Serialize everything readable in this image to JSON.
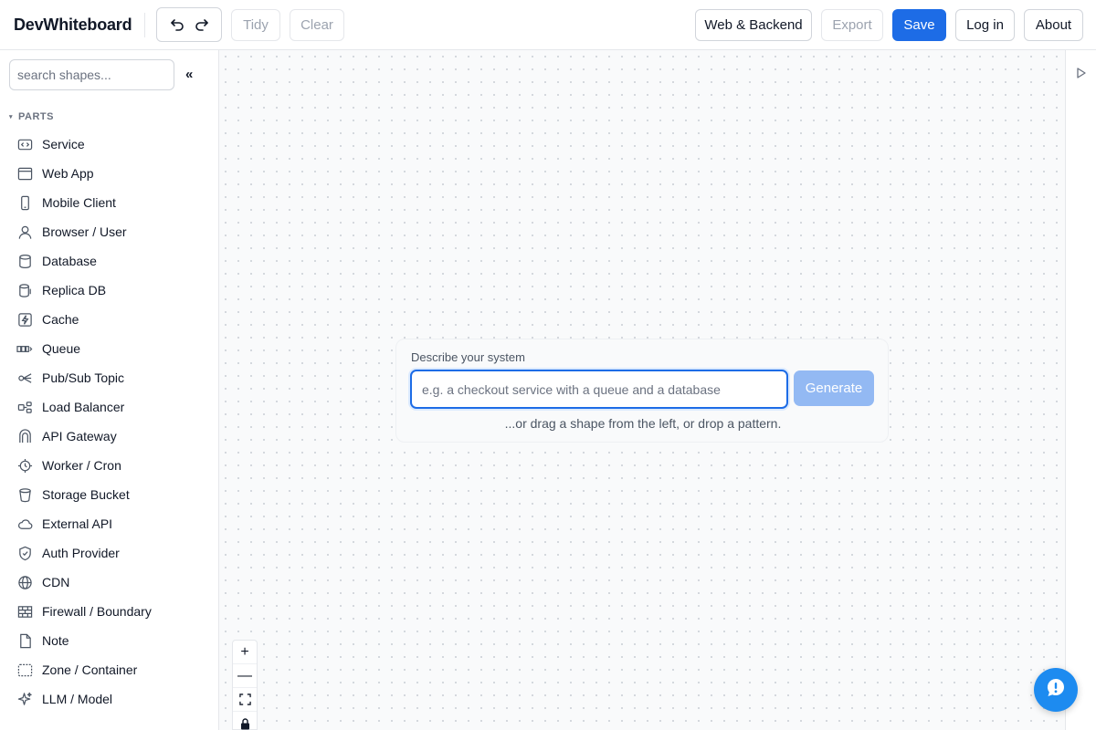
{
  "app": {
    "title": "DevWhiteboard"
  },
  "toolbar": {
    "undo_icon": "undo-icon",
    "redo_icon": "redo-icon",
    "tidy": "Tidy",
    "clear": "Clear",
    "stack": "Web & Backend",
    "export": "Export",
    "save": "Save",
    "login": "Log in",
    "about": "About"
  },
  "sidebar": {
    "search_placeholder": "search shapes...",
    "collapse": "«",
    "section_title": "PARTS",
    "items": [
      {
        "label": "Service",
        "icon": "service-icon"
      },
      {
        "label": "Web App",
        "icon": "web-app-icon"
      },
      {
        "label": "Mobile Client",
        "icon": "mobile-icon"
      },
      {
        "label": "Browser / User",
        "icon": "user-icon"
      },
      {
        "label": "Database",
        "icon": "database-icon"
      },
      {
        "label": "Replica DB",
        "icon": "replica-db-icon"
      },
      {
        "label": "Cache",
        "icon": "cache-icon"
      },
      {
        "label": "Queue",
        "icon": "queue-icon"
      },
      {
        "label": "Pub/Sub Topic",
        "icon": "pubsub-icon"
      },
      {
        "label": "Load Balancer",
        "icon": "load-balancer-icon"
      },
      {
        "label": "API Gateway",
        "icon": "api-gateway-icon"
      },
      {
        "label": "Worker / Cron",
        "icon": "worker-icon"
      },
      {
        "label": "Storage Bucket",
        "icon": "bucket-icon"
      },
      {
        "label": "External API",
        "icon": "cloud-icon"
      },
      {
        "label": "Auth Provider",
        "icon": "shield-icon"
      },
      {
        "label": "CDN",
        "icon": "globe-icon"
      },
      {
        "label": "Firewall / Boundary",
        "icon": "firewall-icon"
      },
      {
        "label": "Note",
        "icon": "note-icon"
      },
      {
        "label": "Zone / Container",
        "icon": "zone-icon"
      },
      {
        "label": "LLM / Model",
        "icon": "sparkle-icon"
      }
    ]
  },
  "prompt": {
    "label": "Describe your system",
    "placeholder": "e.g. a checkout service with a queue and a database",
    "generate": "Generate",
    "hint": "...or drag a shape from the left, or drop a pattern."
  },
  "zoom_controls": {
    "zoom_in": "+",
    "zoom_out": "—"
  },
  "colors": {
    "accent": "#1d6ce6",
    "generate_disabled": "#93b9f3",
    "fab": "#1d8bf0"
  }
}
